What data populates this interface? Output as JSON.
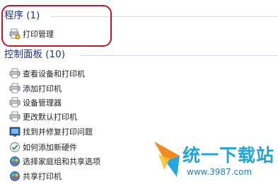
{
  "programs": {
    "header": "程序 (1)",
    "items": [
      {
        "label": "打印管理",
        "icon": "print-management-icon"
      }
    ]
  },
  "control_panel": {
    "header": "控制面板 (10)",
    "items": [
      {
        "label": "查看设备和打印机",
        "icon": "printer-icon"
      },
      {
        "label": "添加打印机",
        "icon": "printer-icon"
      },
      {
        "label": "设备管理器",
        "icon": "printer-icon"
      },
      {
        "label": "更改默认打印机",
        "icon": "printer-icon"
      },
      {
        "label": "找到并修复打印问题",
        "icon": "troubleshoot-icon"
      },
      {
        "label": "如何添加新硬件",
        "icon": "hardware-icon"
      },
      {
        "label": "选择家庭组和共享选项",
        "icon": "homegroup-icon"
      },
      {
        "label": "共享打印机",
        "icon": "homegroup-icon"
      }
    ]
  },
  "watermark": {
    "brand": "统一下载站",
    "url": "www.3987.com"
  },
  "colors": {
    "group_header": "#1e3287",
    "highlight": "#c8142a",
    "watermark": "#24a3d8"
  }
}
